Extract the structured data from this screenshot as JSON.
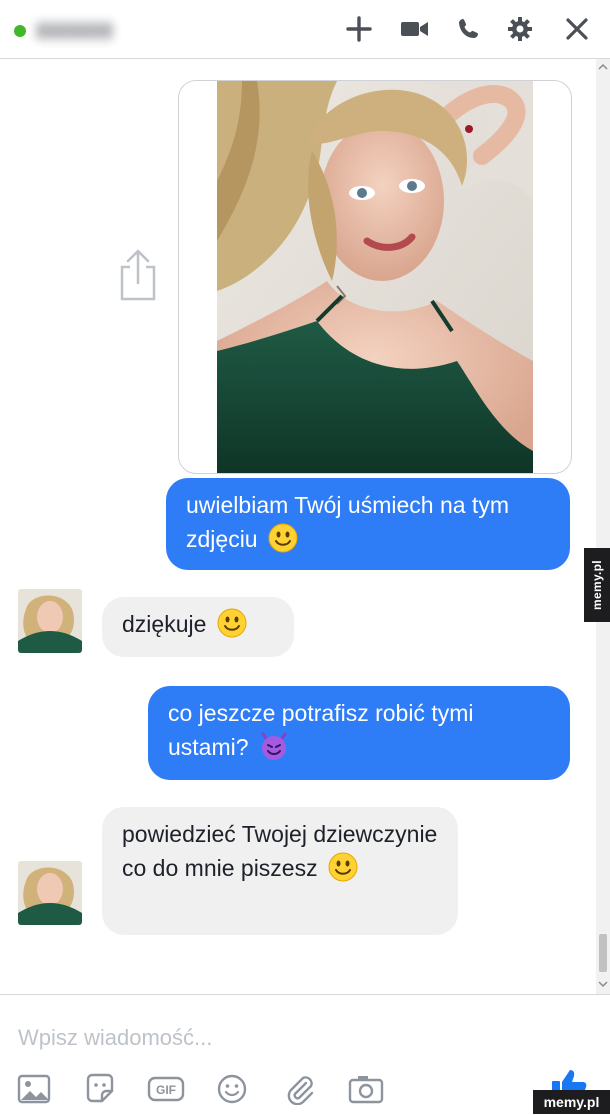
{
  "header": {
    "contact_name": "▮▮▮▮▮▮▮",
    "status_color": "#42b72a",
    "icons": [
      "plus-icon",
      "video-camera-icon",
      "phone-icon",
      "gear-icon",
      "close-icon"
    ]
  },
  "messages": [
    {
      "side": "out",
      "type": "image",
      "text": ""
    },
    {
      "side": "out",
      "text": "uwielbiam Twój uśmiech na tym zdjęciu",
      "emoji": "smile"
    },
    {
      "side": "in",
      "text": "dziękuje",
      "emoji": "smile"
    },
    {
      "side": "out",
      "text": "co jeszcze potrafisz robić tymi ustami?",
      "emoji": "devil"
    },
    {
      "side": "in",
      "text": "powiedzieć Twojej dziewczynie co do mnie piszesz",
      "emoji": "smile"
    }
  ],
  "composer": {
    "placeholder": "Wpisz wiadomość...",
    "tools": [
      "image-icon",
      "sticker-icon",
      "gif-icon",
      "emoji-icon",
      "attachment-icon",
      "camera-icon",
      "thumbs-up-icon"
    ]
  },
  "watermark": {
    "side_text": "memy.pl",
    "corner_text": "memy.pl"
  },
  "colors": {
    "outgoing": "#2e7cf6",
    "incoming": "#f1f0f0",
    "accent": "#1877f2"
  }
}
